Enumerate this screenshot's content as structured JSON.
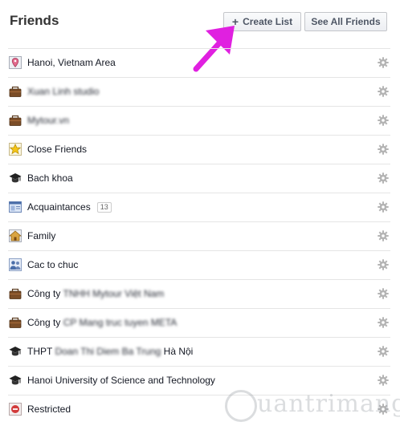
{
  "header": {
    "title": "Friends",
    "create_list_label": "Create List",
    "see_all_label": "See All Friends"
  },
  "lists": [
    {
      "label": "Hanoi, Vietnam Area",
      "icon": "location-pin-icon",
      "blurred": false
    },
    {
      "label": "Xuan Linh studio",
      "icon": "briefcase-icon",
      "blurred": true
    },
    {
      "label": "Mytour.vn",
      "icon": "briefcase-icon",
      "blurred": true
    },
    {
      "label": "Close Friends",
      "icon": "star-icon",
      "blurred": false
    },
    {
      "label": "Bach khoa",
      "icon": "graduation-cap-icon",
      "blurred": false
    },
    {
      "label": "Acquaintances",
      "icon": "acquaintances-icon",
      "blurred": false,
      "count": "13"
    },
    {
      "label": "Family",
      "icon": "house-icon",
      "blurred": false
    },
    {
      "label": "Cac to chuc",
      "icon": "people-icon",
      "blurred": false
    },
    {
      "label": "Công ty",
      "suffix": "TNHH Mytour Việt Nam",
      "icon": "briefcase-icon",
      "blurred": false
    },
    {
      "label": "Công ty",
      "suffix": "CP Mang truc tuyen META",
      "icon": "briefcase-icon",
      "blurred": false
    },
    {
      "label": "THPT",
      "suffix": "Doan Thi Diem Ba Trung",
      "label_end": "Hà Nội",
      "icon": "graduation-cap-icon",
      "blurred": false
    },
    {
      "label": "Hanoi University of Science and Technology",
      "icon": "graduation-cap-icon",
      "blurred": false
    },
    {
      "label": "Restricted",
      "icon": "restricted-icon",
      "blurred": false
    }
  ],
  "watermark": {
    "text": "uantrimang"
  },
  "colors": {
    "arrow": "#e020e0",
    "gear": "#b4b4b4",
    "border": "#e5e5e5"
  }
}
